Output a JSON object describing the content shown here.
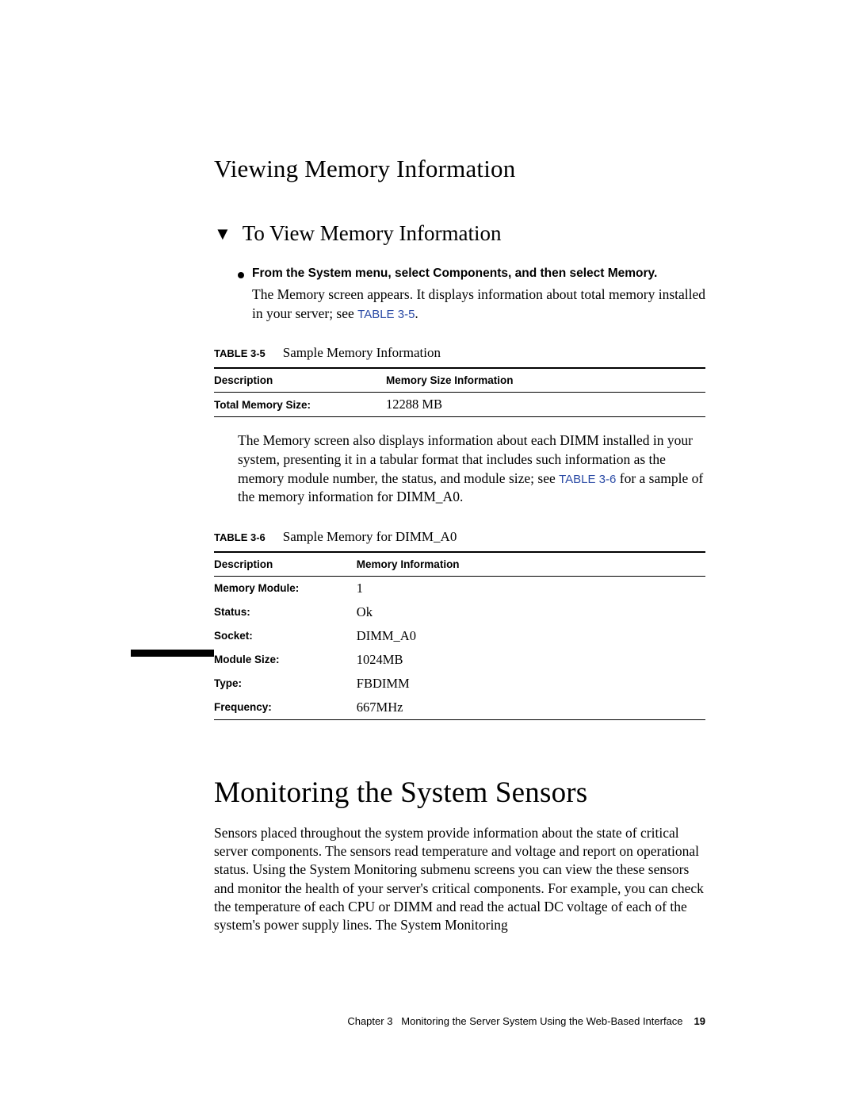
{
  "section_h2": "Viewing Memory Information",
  "procedure_h3": "To View Memory Information",
  "step_bold": "From the System menu, select Components, and then select Memory.",
  "step_body_1": "The Memory screen appears. It displays information about total memory installed in your server; see ",
  "ref1": "TABLE 3-5",
  "step_body_1_end": ".",
  "table35": {
    "label": "TABLE 3-5",
    "title": "Sample Memory Information",
    "headers": [
      "Description",
      "Memory Size Information"
    ],
    "rows": [
      {
        "desc": "Total Memory Size:",
        "val": "12288 MB"
      }
    ]
  },
  "mid_para_1": "The Memory screen also displays information about each DIMM installed in your system, presenting it in a tabular format that includes such information as the memory module number, the status, and module size; see ",
  "ref2": "TABLE 3-6",
  "mid_para_2": " for a sample of the memory information for DIMM_A0.",
  "table36": {
    "label": "TABLE 3-6",
    "title": "Sample Memory for DIMM_A0",
    "headers": [
      "Description",
      "Memory Information"
    ],
    "rows": [
      {
        "desc": "Memory Module:",
        "val": "1"
      },
      {
        "desc": "Status:",
        "val": "Ok"
      },
      {
        "desc": "Socket:",
        "val": "DIMM_A0"
      },
      {
        "desc": "Module Size:",
        "val": "1024MB"
      },
      {
        "desc": "Type:",
        "val": "FBDIMM"
      },
      {
        "desc": "Frequency:",
        "val": "667MHz"
      }
    ]
  },
  "h1": "Monitoring the System Sensors",
  "body": "Sensors placed throughout the system provide information about the state of critical server components. The sensors read temperature and voltage and report on operational status. Using the System Monitoring submenu screens you can view the these sensors and monitor the health of your server's critical components. For example, you can check the temperature of each CPU or DIMM and read the actual DC voltage of each of the system's power supply lines. The System Monitoring",
  "footer_chapter": "Chapter 3",
  "footer_title": "Monitoring the Server System Using the Web-Based Interface",
  "footer_page": "19"
}
